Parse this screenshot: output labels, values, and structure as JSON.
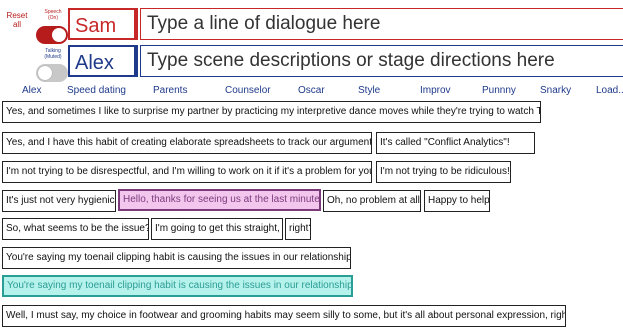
{
  "reset_label": "Reset all",
  "speech_toggle": {
    "label": "Speech (On)",
    "state": "on"
  },
  "talking_toggle": {
    "label": "Talking (Muted)",
    "state": "off"
  },
  "characters": {
    "speaker_name": "Sam",
    "scene_name": "Alex"
  },
  "inputs": {
    "dialogue_placeholder": "Type a line of dialogue here",
    "scene_placeholder": "Type scene descriptions or stage directions here"
  },
  "nav": [
    "Alex",
    "Speed dating",
    "Parents",
    "Counselor",
    "Oscar",
    "Style",
    "Improv",
    "Punnny",
    "Snarky",
    "Load..."
  ],
  "messages": {
    "m1": "Yes, and sometimes I like to surprise my partner by practicing my interpretive dance moves while they're trying to watch TV.",
    "m2": "Yes, and I have this habit of creating elaborate spreadsheets to track our arguments.",
    "m3": "It's called \"Conflict Analytics\"!",
    "m4": "I'm not trying to be disrespectful, and I'm willing to work on it if it's a problem for you.",
    "m5": "I'm not trying to be ridiculous!",
    "m6": "It's just not very hygienic!",
    "m7": "Hello, thanks for seeing us at the last minute.",
    "m8": "Oh, no problem at all!",
    "m9": "Happy to help.",
    "m10": "So, what seems to be the issue?",
    "m11": "I'm going to get this straight,",
    "m12": "right?",
    "m13": "You're saying my toenail clipping habit is causing the issues in our relationship?",
    "m14": "You're saying my toenail clipping habit is causing the issues in our relationship?",
    "m15": "Well, I must say, my choice in footwear and grooming habits may seem silly to some, but it's all about personal expression, right?"
  },
  "colors": {
    "speaker_red": "#c62828",
    "scene_blue": "#1f3a8a",
    "highlight_pink": "#f3c6ee",
    "highlight_teal": "#b6f2ec"
  }
}
